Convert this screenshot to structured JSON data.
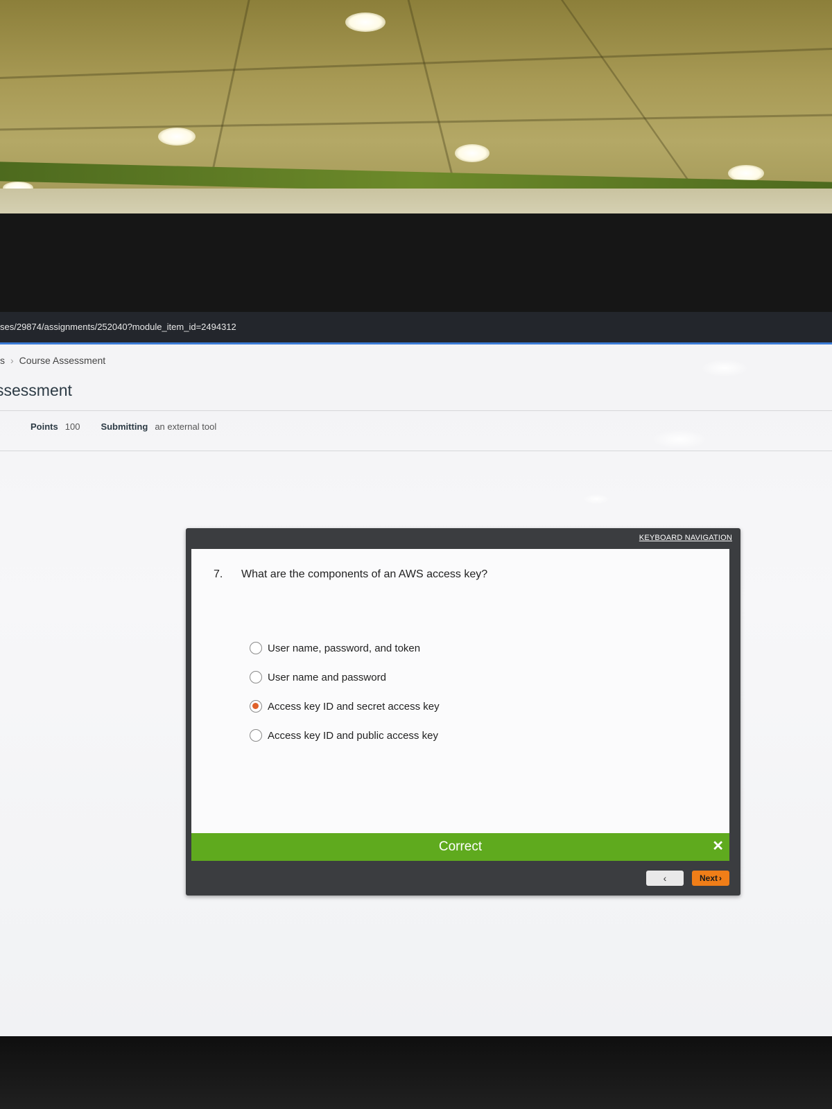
{
  "browser": {
    "url_fragment": "ses/29874/assignments/252040?module_item_id=2494312"
  },
  "breadcrumb": {
    "prefix": "s",
    "current": "Course Assessment"
  },
  "page": {
    "title": "ssessment"
  },
  "meta": {
    "points_label": "Points",
    "points_value": "100",
    "submitting_label": "Submitting",
    "submitting_value": "an external tool"
  },
  "quiz": {
    "keyboard_nav_label": "KEYBOARD NAVIGATION",
    "question_number": "7.",
    "question_text": "What are the components of an AWS access key?",
    "options": [
      {
        "label": "User name, password, and token",
        "selected": false
      },
      {
        "label": "User name and password",
        "selected": false
      },
      {
        "label": "Access key ID and secret access key",
        "selected": true
      },
      {
        "label": "Access key ID and public access key",
        "selected": false
      }
    ],
    "feedback_text": "Correct",
    "close_symbol": "✕",
    "prev_symbol": "‹",
    "next_label": "Next",
    "next_symbol": "›",
    "feedback_color": "#5faa1e",
    "selected_color": "#e0612a",
    "next_color": "#f07e18"
  }
}
